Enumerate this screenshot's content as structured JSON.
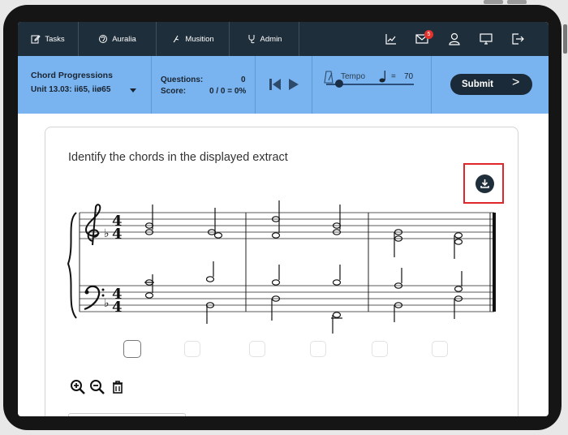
{
  "nav": {
    "tasks_label": "Tasks",
    "auralia_label": "Auralia",
    "musition_label": "Musition",
    "admin_label": "Admin",
    "messages_count": "5"
  },
  "toolbar": {
    "course_title": "Chord Progressions",
    "unit_title": "Unit 13.03: ii65, iiø65",
    "questions_label": "Questions:",
    "questions_value": "0",
    "score_label": "Score:",
    "score_value": "0 / 0 = 0%",
    "tempo_label": "Tempo",
    "tempo_equals": "=",
    "tempo_value": "70",
    "tempo_slider_fraction": 0.15,
    "submit_label": "Submit"
  },
  "question": {
    "text": "Identify the chords in the displayed extract"
  },
  "score_notation": {
    "clefs": [
      "treble",
      "bass"
    ],
    "key_signature": "one flat",
    "time_signature": "4/4",
    "measures": 3
  },
  "answers": {
    "count": 6,
    "active_index": 0
  },
  "colors": {
    "topbar": "#1f2e3b",
    "toolbar": "#79b4f0",
    "submit": "#1b2a38",
    "highlight": "#e0252b",
    "badge": "#e3322c"
  },
  "icons": [
    "edit-icon",
    "ear-icon",
    "musition-icon",
    "stethoscope-icon",
    "chart-icon",
    "mail-icon",
    "user-icon",
    "monitor-icon",
    "logout-icon",
    "metronome-icon",
    "quarter-note-icon",
    "skip-back-icon",
    "play-icon",
    "download-icon",
    "zoom-in-icon",
    "zoom-out-icon",
    "trash-icon"
  ]
}
